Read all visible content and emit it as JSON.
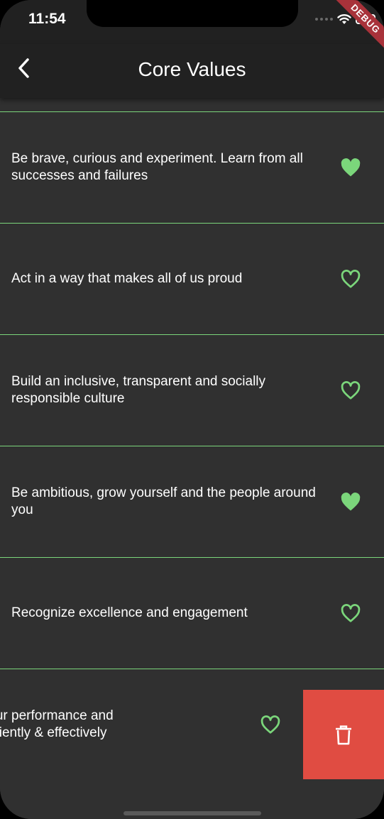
{
  "status_bar": {
    "time": "11:54"
  },
  "debug_banner": {
    "label": "DEBUG"
  },
  "app_bar": {
    "title": "Core Values",
    "back_icon": "chevron-left-icon"
  },
  "colors": {
    "accent_green": "#7bd67b",
    "delete_red": "#e04c42",
    "surface": "#303030",
    "app_bar": "#212121"
  },
  "values": [
    {
      "text": "Be brave, curious and experiment. Learn from all successes and failures",
      "favorite": true
    },
    {
      "text": "Act in a way that makes all of us proud",
      "favorite": false
    },
    {
      "text": "Build an inclusive, transparent and socially responsible culture",
      "favorite": false
    },
    {
      "text": "Be ambitious, grow yourself and the people around you",
      "favorite": true
    },
    {
      "text": "Recognize excellence and engagement",
      "favorite": false
    },
    {
      "text": "Step up your performance and deliver efficiently & effectively",
      "favorite": false,
      "swiped": true
    }
  ],
  "swipe_action": {
    "icon": "trash-icon"
  }
}
